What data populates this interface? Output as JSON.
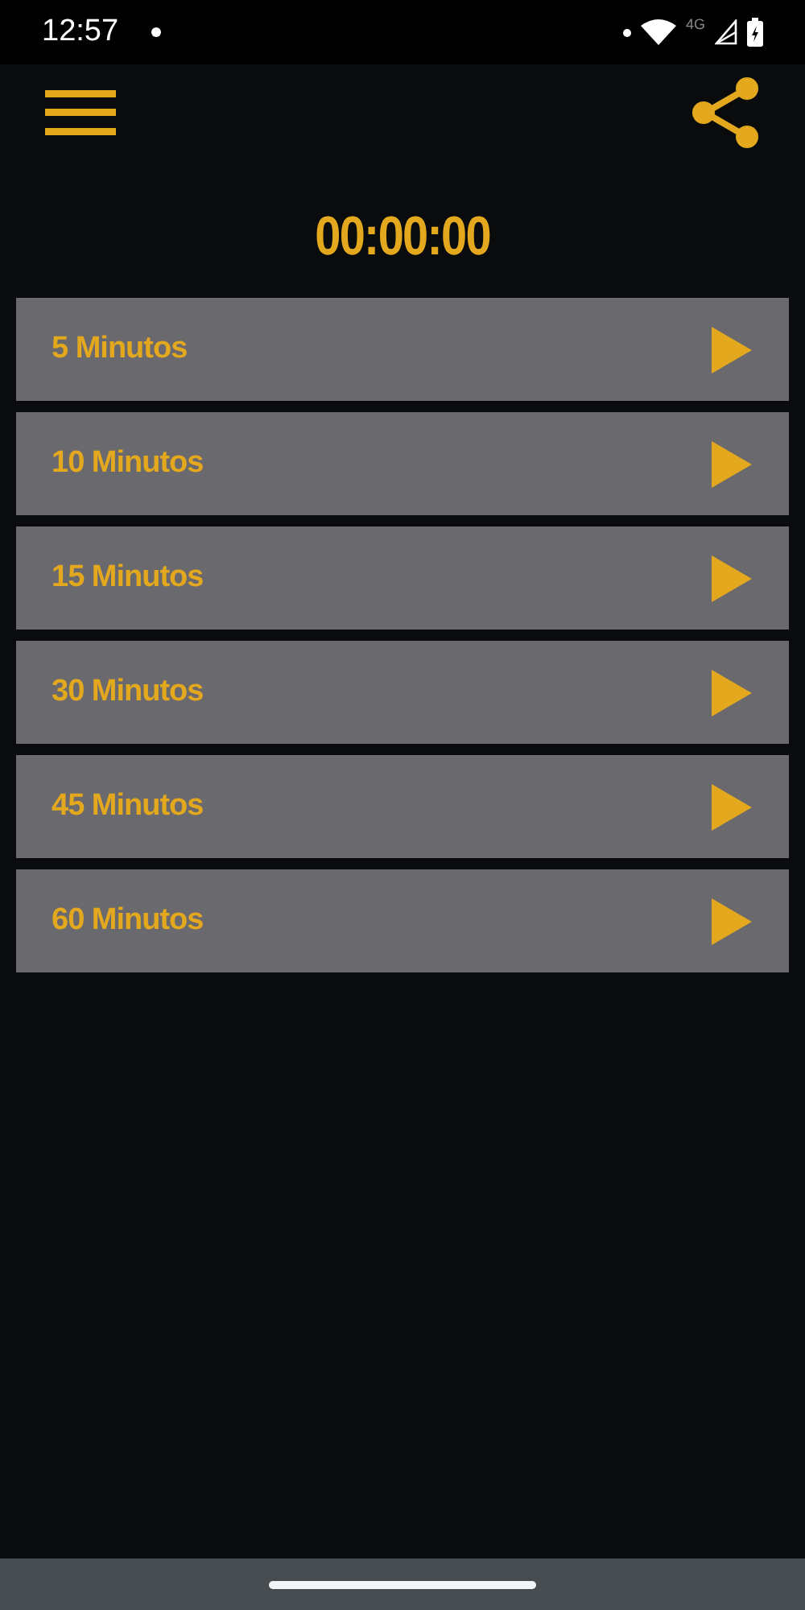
{
  "status_bar": {
    "time": "12:57",
    "network": "4G"
  },
  "timer": {
    "display": "00:00:00"
  },
  "presets": [
    {
      "label": "5 Minutos"
    },
    {
      "label": "10 Minutos"
    },
    {
      "label": "15 Minutos"
    },
    {
      "label": "30 Minutos"
    },
    {
      "label": "45 Minutos"
    },
    {
      "label": "60 Minutos"
    }
  ]
}
